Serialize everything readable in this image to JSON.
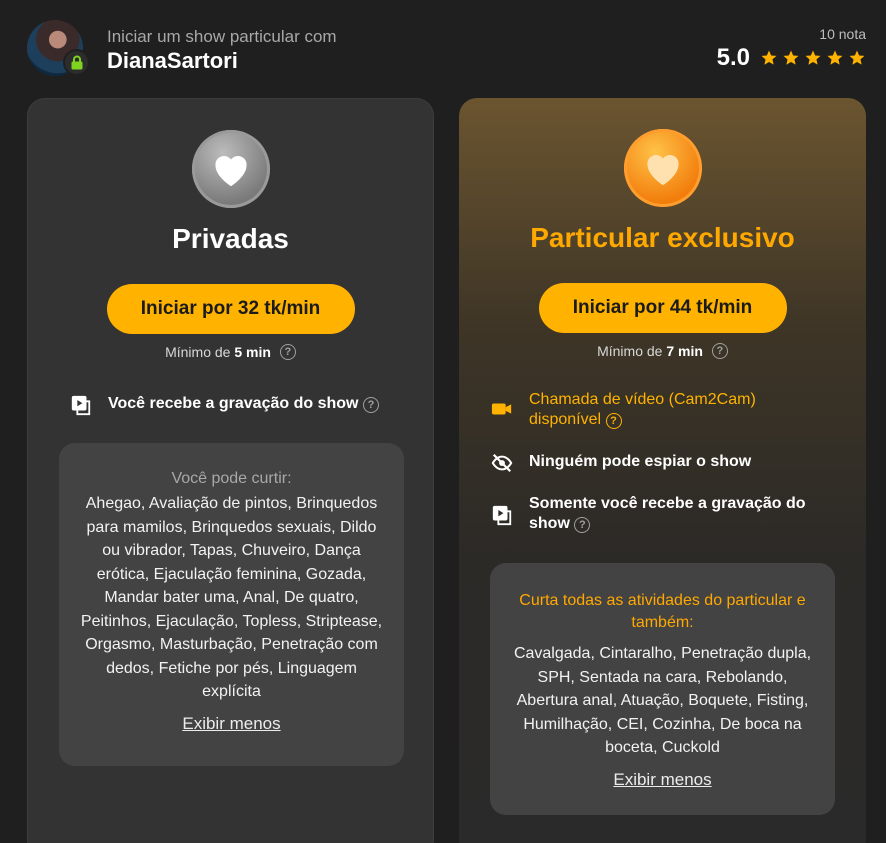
{
  "header": {
    "subtitle": "Iniciar um show particular com",
    "model_name": "DianaSartori",
    "rating_count": "10 nota",
    "rating_value": "5.0",
    "stars": 5
  },
  "cards": [
    {
      "title": "Privadas",
      "button_label": "Iniciar por 32 tk/min",
      "min_prefix": "Mínimo de",
      "min_value": "5 min",
      "features": [
        {
          "icon": "video-recording-icon",
          "text": "Você recebe a gravação do show",
          "help": "?"
        }
      ],
      "curtir_title": "Você pode curtir:",
      "curtir_list": "Ahegao, Avaliação de pintos, Brinquedos para mamilos, Brinquedos sexuais, Dildo ou vibrador, Tapas, Chuveiro, Dança erótica, Ejaculação feminina, Gozada, Mandar bater uma, Anal, De quatro, Peitinhos, Ejaculação, Topless, Striptease, Orgasmo, Masturbação, Penetração com dedos, Fetiche por pés, Linguagem explícita",
      "show_less": "Exibir menos"
    },
    {
      "title": "Particular exclusivo",
      "button_label": "Iniciar por 44 tk/min",
      "min_prefix": "Mínimo de",
      "min_value": "7 min",
      "features": [
        {
          "icon": "camera-icon",
          "text": "Chamada de vídeo (Cam2Cam) disponível",
          "help": "?"
        },
        {
          "icon": "eye-off-icon",
          "text": "Ninguém pode espiar o show"
        },
        {
          "icon": "video-recording-icon",
          "text": "Somente você recebe a gravação do show",
          "help": "?"
        }
      ],
      "curtir_title": "Curta todas as atividades do particular e também:",
      "curtir_list": "Cavalgada, Cintaralho, Penetração dupla, SPH, Sentada na cara, Rebolando, Abertura anal, Atuação, Boquete, Fisting, Humilhação, CEI, Cozinha, De boca na boceta, Cuckold",
      "show_less": "Exibir menos"
    }
  ],
  "colors": {
    "accent": "#ffb300",
    "accent_text": "#ffa800",
    "background": "#1f1f1f",
    "card": "#333333"
  }
}
